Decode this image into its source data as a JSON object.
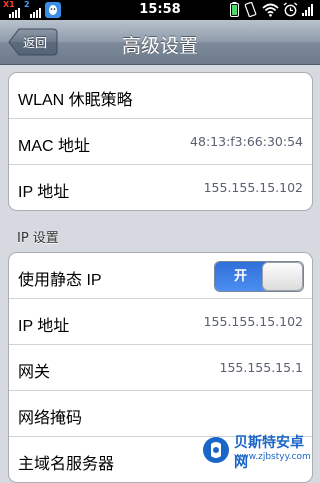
{
  "status_bar": {
    "time": "15:58",
    "signal_1_label": "X1",
    "signal_2_label": "2"
  },
  "navbar": {
    "back_label": "返回",
    "title": "高级设置"
  },
  "group1": {
    "rows": [
      {
        "label": "WLAN 休眠策略",
        "value": ""
      },
      {
        "label": "MAC 地址",
        "value": "48:13:f3:66:30:54"
      },
      {
        "label": "IP 地址",
        "value": "155.155.15.102"
      }
    ]
  },
  "ip_section": {
    "header": "IP 设置",
    "static_ip": {
      "label": "使用静态 IP",
      "toggle_on_label": "开",
      "enabled": true
    },
    "rows": [
      {
        "label": "IP 地址",
        "value": "155.155.15.102"
      },
      {
        "label": "网关",
        "value": "155.155.15.1"
      },
      {
        "label": "网络掩码",
        "value": ""
      },
      {
        "label": "主域名服务器",
        "value": ""
      }
    ]
  },
  "watermark": {
    "title": "贝斯特安卓网",
    "url": "www.zjbstyy.com"
  },
  "colors": {
    "navbar_top": "#b9c2cd",
    "navbar_bottom": "#6e7b8c",
    "toggle_on": "#2f6fd9",
    "background": "#d6d9df"
  }
}
